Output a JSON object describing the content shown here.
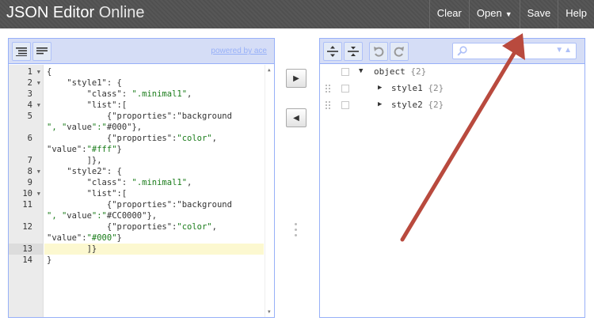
{
  "app": {
    "title_bold": "JSON Editor",
    "title_light": "Online"
  },
  "menu": {
    "clear": "Clear",
    "open": "Open",
    "open_caret": "▼",
    "save": "Save",
    "help": "Help"
  },
  "left_panel": {
    "powered_by": "powered by ace"
  },
  "code": {
    "lines": [
      {
        "num": "1",
        "fold": "▼"
      },
      {
        "num": "2",
        "fold": "▼"
      },
      {
        "num": "3",
        "fold": ""
      },
      {
        "num": "4",
        "fold": "▼"
      },
      {
        "num": "5",
        "fold": ""
      },
      {
        "num": "",
        "fold": ""
      },
      {
        "num": "6",
        "fold": ""
      },
      {
        "num": "",
        "fold": ""
      },
      {
        "num": "7",
        "fold": ""
      },
      {
        "num": "8",
        "fold": "▼"
      },
      {
        "num": "9",
        "fold": ""
      },
      {
        "num": "10",
        "fold": "▼"
      },
      {
        "num": "11",
        "fold": ""
      },
      {
        "num": "",
        "fold": ""
      },
      {
        "num": "12",
        "fold": ""
      },
      {
        "num": "",
        "fold": ""
      },
      {
        "num": "13",
        "fold": ""
      },
      {
        "num": "14",
        "fold": ""
      }
    ],
    "text": [
      "{",
      "    \"style1\": {",
      "        \"class\": \".minimal1\",",
      "        \"list\":[",
      "            {\"proporties\":\"background",
      "\", \"value\":\"#000\"},",
      "            {\"proporties\":\"color\",",
      "\"value\":\"#fff\"}",
      "        ]},",
      "    \"style2\": {",
      "        \"class\": \".minimal1\",",
      "        \"list\":[",
      "            {\"proporties\":\"background",
      "\", \"value\":\"#CC0000\"},",
      "            {\"proporties\":\"color\",",
      "\"value\":\"#000\"}",
      "        ]}",
      "}"
    ]
  },
  "tree": {
    "root": {
      "label": "object",
      "count": "{2}"
    },
    "children": [
      {
        "label": "style1",
        "count": "{2}"
      },
      {
        "label": "style2",
        "count": "{2}"
      }
    ]
  },
  "colors": {
    "topbar": "#535353",
    "panel_border": "#97b0f8",
    "arrow": "#b94a3e"
  }
}
